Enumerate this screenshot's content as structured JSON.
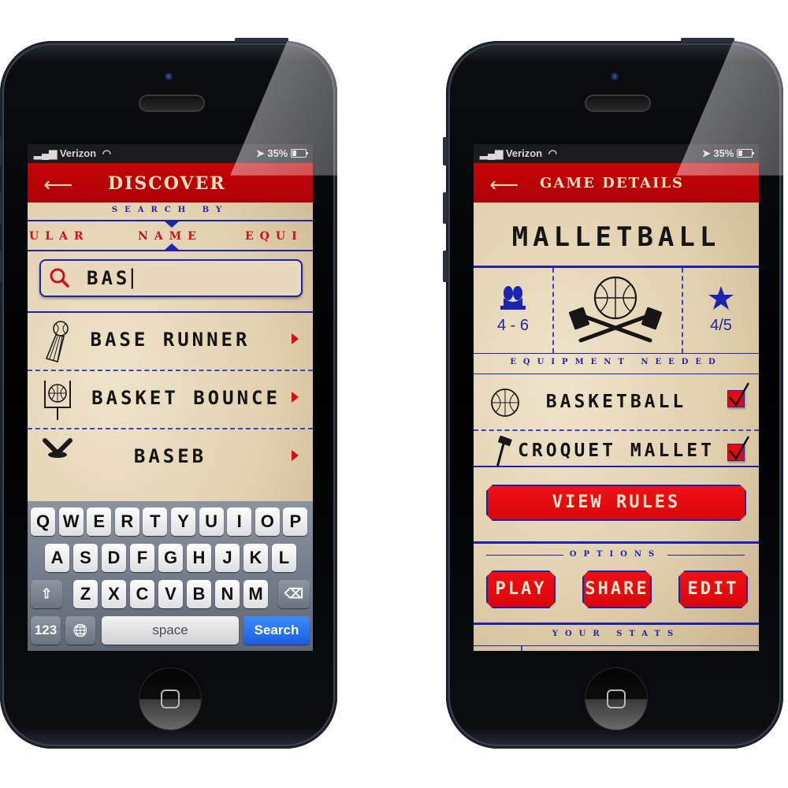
{
  "status_bar": {
    "carrier": "Verizon",
    "battery": "35%",
    "icons": [
      "signal-bars-icon",
      "wifi-icon",
      "location-arrow-icon",
      "battery-icon"
    ]
  },
  "discover_screen": {
    "nav": {
      "back_icon": "back-arrow-icon",
      "title": "DISCOVER"
    },
    "search_by_label": "SEARCH BY",
    "search_tabs": [
      {
        "label": "ULAR",
        "selected": false
      },
      {
        "label": "NAME",
        "selected": true
      },
      {
        "label": "EQUI",
        "selected": false
      }
    ],
    "search": {
      "icon": "search-icon",
      "value": "BAS"
    },
    "results": [
      {
        "label": "BASE RUNNER",
        "icon": "baseball-shuttlecock-icon"
      },
      {
        "label": "BASKET BOUNCE",
        "icon": "basketball-hoop-icon"
      },
      {
        "label": "BASEB",
        "icon": "crossed-bats-icon"
      }
    ],
    "keyboard": {
      "row1": [
        "Q",
        "W",
        "E",
        "R",
        "T",
        "Y",
        "U",
        "I",
        "O",
        "P"
      ],
      "row2": [
        "A",
        "S",
        "D",
        "F",
        "G",
        "H",
        "J",
        "K",
        "L"
      ],
      "row3": [
        "Z",
        "X",
        "C",
        "V",
        "B",
        "N",
        "M"
      ],
      "numbers_key": "123",
      "space_key": "space",
      "search_key": "Search",
      "icons": [
        "shift-icon",
        "backspace-icon",
        "globe-icon"
      ]
    }
  },
  "details_screen": {
    "nav": {
      "back_icon": "back-arrow-icon",
      "title": "GAME DETAILS"
    },
    "game_title": "MALLETBALL",
    "players": {
      "icon": "players-icon",
      "value": "4 - 6"
    },
    "rating": {
      "icon": "star-icon",
      "value": "4/5"
    },
    "hero_icon": "basketball-crossed-mallets-icon",
    "equipment_header": "EQUIPMENT NEEDED",
    "equipment": [
      {
        "label": "BASKETBALL",
        "icon": "basketball-icon",
        "checked": true
      },
      {
        "label": "CROQUET MALLET",
        "icon": "mallet-icon",
        "checked": true
      }
    ],
    "view_rules": "VIEW RULES",
    "options_header": "OPTIONS",
    "options": [
      "PLAY",
      "SHARE",
      "EDIT"
    ],
    "stats_header": "YOUR STATS"
  },
  "colors": {
    "nav_red": "#c40509",
    "accent_blue": "#1d23b0",
    "button_red": "#f01014",
    "parchment": "#e9dcc3",
    "keyboard_search_blue": "#1a5ee6"
  }
}
